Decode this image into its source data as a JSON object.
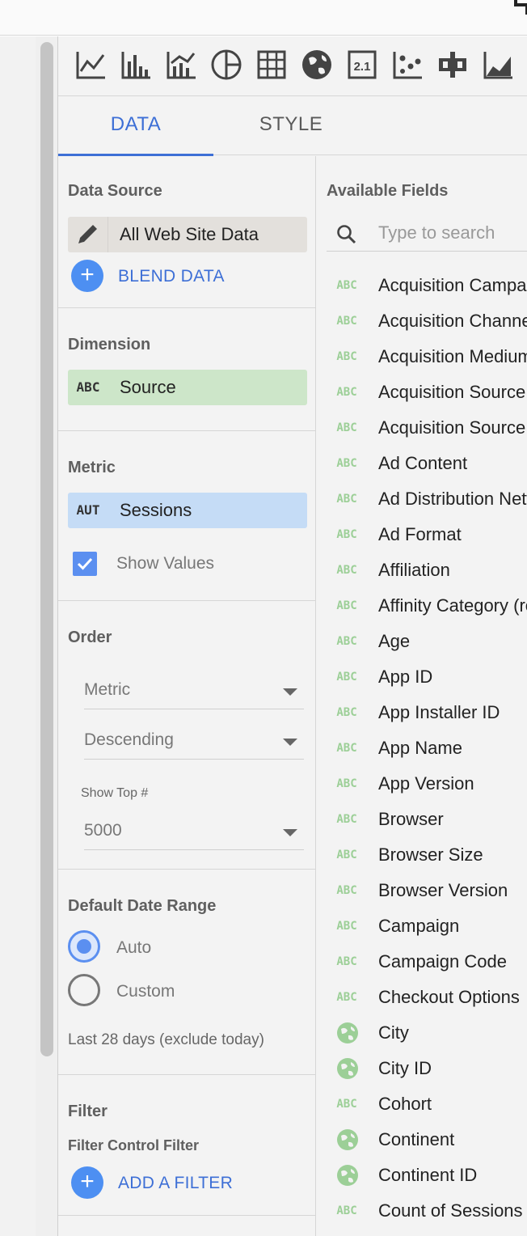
{
  "chart_type_icons": [
    "time-series-icon",
    "bar-chart-icon",
    "combo-chart-icon",
    "pie-chart-icon",
    "table-icon",
    "geo-map-icon",
    "scorecard-icon",
    "scatter-chart-icon",
    "bullet-chart-icon",
    "area-chart-icon"
  ],
  "scorecard_icon_text": "2.1",
  "tabs": [
    {
      "label": "DATA",
      "active": true
    },
    {
      "label": "STYLE",
      "active": false
    }
  ],
  "data_source": {
    "title": "Data Source",
    "name": "All Web Site Data",
    "blend_label": "BLEND DATA"
  },
  "dimension": {
    "title": "Dimension",
    "type": "ABC",
    "name": "Source"
  },
  "metric": {
    "title": "Metric",
    "type": "AUT",
    "name": "Sessions",
    "show_values_label": "Show Values",
    "show_values_checked": true
  },
  "order": {
    "title": "Order",
    "sort_by": "Metric",
    "direction": "Descending",
    "show_top_label": "Show Top #",
    "show_top_value": "5000"
  },
  "date_range": {
    "title": "Default Date Range",
    "options": [
      {
        "label": "Auto",
        "selected": true
      },
      {
        "label": "Custom",
        "selected": false
      }
    ],
    "note": "Last 28 days (exclude today)"
  },
  "filter": {
    "title": "Filter",
    "subtitle": "Filter Control Filter",
    "add_label": "ADD A FILTER"
  },
  "available_fields": {
    "title": "Available Fields",
    "search_placeholder": "Type to search",
    "items": [
      {
        "type": "ABC",
        "name": "Acquisition Campaign"
      },
      {
        "type": "ABC",
        "name": "Acquisition Channel"
      },
      {
        "type": "ABC",
        "name": "Acquisition Medium"
      },
      {
        "type": "ABC",
        "name": "Acquisition Source"
      },
      {
        "type": "ABC",
        "name": "Acquisition Source / Medium"
      },
      {
        "type": "ABC",
        "name": "Ad Content"
      },
      {
        "type": "ABC",
        "name": "Ad Distribution Network"
      },
      {
        "type": "ABC",
        "name": "Ad Format"
      },
      {
        "type": "ABC",
        "name": "Affiliation"
      },
      {
        "type": "ABC",
        "name": "Affinity Category (reach)"
      },
      {
        "type": "ABC",
        "name": "Age"
      },
      {
        "type": "ABC",
        "name": "App ID"
      },
      {
        "type": "ABC",
        "name": "App Installer ID"
      },
      {
        "type": "ABC",
        "name": "App Name"
      },
      {
        "type": "ABC",
        "name": "App Version"
      },
      {
        "type": "ABC",
        "name": "Browser"
      },
      {
        "type": "ABC",
        "name": "Browser Size"
      },
      {
        "type": "ABC",
        "name": "Browser Version"
      },
      {
        "type": "ABC",
        "name": "Campaign"
      },
      {
        "type": "ABC",
        "name": "Campaign Code"
      },
      {
        "type": "ABC",
        "name": "Checkout Options"
      },
      {
        "type": "geo",
        "name": "City"
      },
      {
        "type": "geo",
        "name": "City ID"
      },
      {
        "type": "ABC",
        "name": "Cohort"
      },
      {
        "type": "geo",
        "name": "Continent"
      },
      {
        "type": "geo",
        "name": "Continent ID"
      },
      {
        "type": "ABC",
        "name": "Count of Sessions"
      }
    ]
  },
  "colors": {
    "accent": "#3d6fd6",
    "dimension_chip": "#cde6c9",
    "metric_chip": "#c5dcf6",
    "source_chip": "#e3e0dc",
    "field_type": "#9ccf97"
  }
}
